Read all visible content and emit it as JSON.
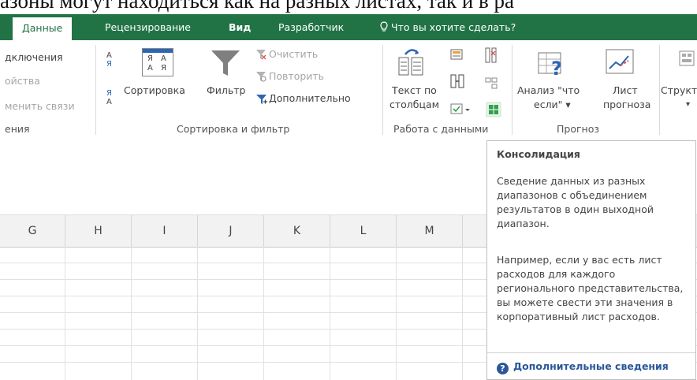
{
  "background_text": "азоны могут находиться как на разных листах, так и в ра",
  "tabs": {
    "data": "Данные",
    "review": "Рецензирование",
    "view": "Вид",
    "developer": "Разработчик",
    "tell_me": "Что вы хотите сделать?"
  },
  "connections_group": {
    "connections": "дключения",
    "properties": "ойства",
    "edit_links": "менить связи",
    "label": "ения"
  },
  "sort_filter_group": {
    "sort": "Сортировка",
    "filter": "Фильтр",
    "clear": "Очистить",
    "reapply": "Повторить",
    "advanced": "Дополнительно",
    "label": "Сортировка и фильтр",
    "sort_az_top": "А",
    "sort_az_bottom": "Я",
    "sort_za_top": "Я",
    "sort_za_bottom": "А",
    "sort_big_cells": [
      "Я",
      "А",
      "А",
      "Я"
    ]
  },
  "data_tools_group": {
    "text_to_columns_line1": "Текст по",
    "text_to_columns_line2": "столбцам",
    "label": "Работа с данными"
  },
  "forecast_group": {
    "what_if_line1": "Анализ \"что",
    "what_if_line2": "если\" ▾",
    "forecast_sheet_line1": "Лист",
    "forecast_sheet_line2": "прогноза",
    "label": "Прогноз"
  },
  "outline_group": {
    "outline": "Структ",
    "arrow": "▾"
  },
  "columns": [
    "G",
    "H",
    "I",
    "J",
    "K",
    "L",
    "M"
  ],
  "tooltip": {
    "title": "Консолидация",
    "para1": "Сведение данных из разных диапазонов с объединением результатов в один выходной диапазон.",
    "para2": "Например, если у вас есть лист расходов для каждого регионального представительства, вы можете свести эти значения в корпоративный лист расходов.",
    "link": "Дополнительные сведения",
    "help_glyph": "?"
  },
  "colors": {
    "ribbon_green": "#217346",
    "link_blue": "#2b579a",
    "accent_filter_blue": "#2b66b5",
    "icon_green": "#33a04b"
  }
}
